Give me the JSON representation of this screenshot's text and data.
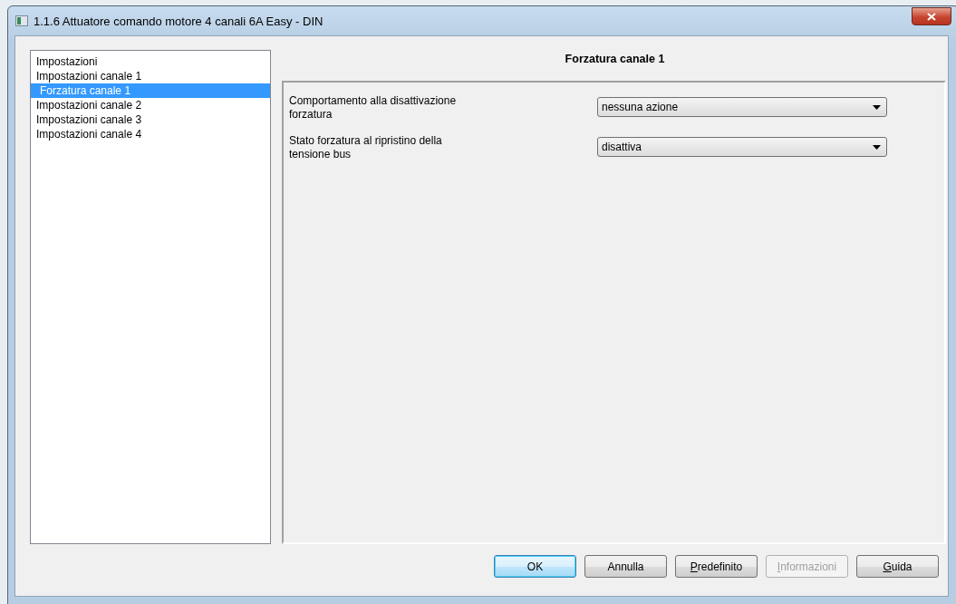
{
  "window": {
    "title": "1.1.6 Attuatore comando motore 4 canali 6A Easy - DIN"
  },
  "sidebar": {
    "items": [
      {
        "label": "Impostazioni",
        "selected": false
      },
      {
        "label": "Impostazioni canale 1",
        "selected": false,
        "children": [
          {
            "label": "Forzatura canale 1",
            "selected": true
          }
        ]
      },
      {
        "label": "Impostazioni canale 2",
        "selected": false
      },
      {
        "label": "Impostazioni canale 3",
        "selected": false
      },
      {
        "label": "Impostazioni canale 4",
        "selected": false
      }
    ]
  },
  "panel": {
    "title": "Forzatura canale 1",
    "params": [
      {
        "label": "Comportamento alla disattivazione forzatura",
        "value": "nessuna azione"
      },
      {
        "label": "Stato forzatura al ripristino della tensione bus",
        "value": "disattiva"
      }
    ]
  },
  "buttons": [
    {
      "label": "OK",
      "default": true,
      "disabled": false,
      "underline_first": false
    },
    {
      "label": "Annulla",
      "default": false,
      "disabled": false,
      "underline_first": false
    },
    {
      "label": "Predefinito",
      "default": false,
      "disabled": false,
      "underline_first": true
    },
    {
      "label": "Informazioni",
      "default": false,
      "disabled": true,
      "underline_first": true
    },
    {
      "label": "Guida",
      "default": false,
      "disabled": false,
      "underline_first": true
    }
  ]
}
